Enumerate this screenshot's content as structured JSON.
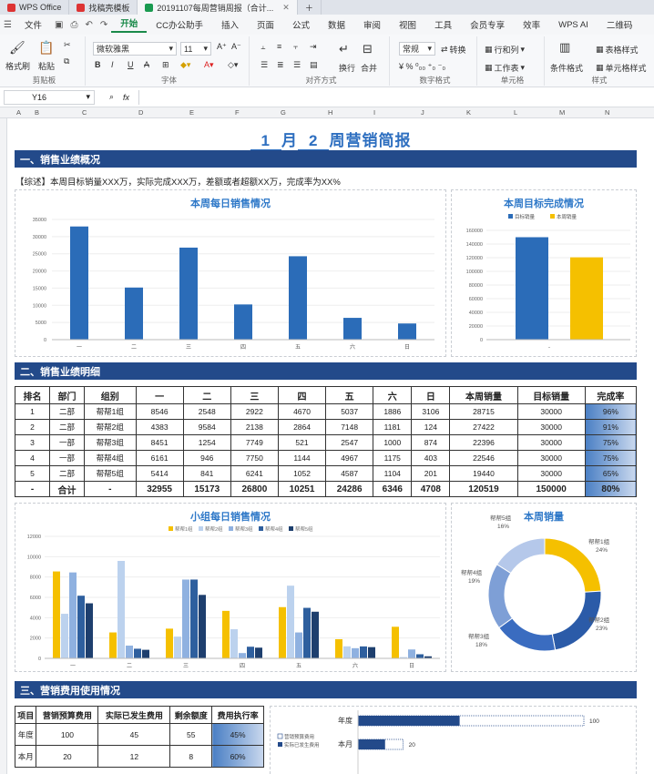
{
  "tabs": [
    {
      "label": "WPS Office",
      "color": "#d33"
    },
    {
      "label": "找稿壳模板",
      "color": "#d33"
    },
    {
      "label": "20191107每周营销周报（合计...",
      "color": "#1a9a50",
      "active": true
    }
  ],
  "menu": {
    "items": [
      "文件",
      "开始",
      "CC办公助手",
      "插入",
      "页面",
      "公式",
      "数据",
      "审阅",
      "视图",
      "工具",
      "会员专享",
      "效率",
      "WPS AI",
      "二维码"
    ],
    "active": "开始"
  },
  "ribbon": {
    "format_painter": "格式刷",
    "paste": "粘贴",
    "clipboard": "剪贴板",
    "font_name": "微软雅黑",
    "font_size": "11",
    "font": "字体",
    "wrap": "换行",
    "merge": "合并",
    "align": "对齐方式",
    "num_format": "常规",
    "convert": "转换",
    "numfmt": "数字格式",
    "rows_cols": "行和列",
    "worksheet": "工作表",
    "cells": "单元格",
    "cond_format": "条件格式",
    "table_style": "表格样式",
    "cell_style": "单元格样式",
    "styles": "样式"
  },
  "formula": {
    "cell": "Y16",
    "fx": "fx"
  },
  "columns": [
    "A",
    "B",
    "C",
    "D",
    "E",
    "F",
    "G",
    "H",
    "I",
    "J",
    "K",
    "L",
    "M",
    "N"
  ],
  "sheet": {
    "title_month": "1",
    "title_mid": "月",
    "title_week": "2",
    "title_tail": "周营销简报",
    "sec1": "一、销售业绩概况",
    "sec2": "二、销售业绩明细",
    "sec3": "三、营销费用使用情况",
    "summary": "【综述】本周目标销量XXX万，实际完成XXX万，差额或者超额XX万，完成率为XX%"
  },
  "chart_daily": {
    "title": "本周每日销售情况"
  },
  "chart_target": {
    "title": "本周目标完成情况",
    "legend": [
      "目标销量",
      "本周销量"
    ]
  },
  "chart_group": {
    "title": "小组每日销售情况",
    "legend": [
      "帮帮1组",
      "帮帮2组",
      "帮帮3组",
      "帮帮4组",
      "帮帮5组"
    ]
  },
  "chart_pie": {
    "title": "本周销量"
  },
  "detail": {
    "headers": [
      "排名",
      "部门",
      "组别",
      "一",
      "二",
      "三",
      "四",
      "五",
      "六",
      "日",
      "本周销量",
      "目标销量",
      "完成率"
    ],
    "rows": [
      [
        "1",
        "二部",
        "帮帮1组",
        "8546",
        "2548",
        "2922",
        "4670",
        "5037",
        "1886",
        "3106",
        "28715",
        "30000",
        "96%"
      ],
      [
        "2",
        "二部",
        "帮帮2组",
        "4383",
        "9584",
        "2138",
        "2864",
        "7148",
        "1181",
        "124",
        "27422",
        "30000",
        "91%"
      ],
      [
        "3",
        "一部",
        "帮帮3组",
        "8451",
        "1254",
        "7749",
        "521",
        "2547",
        "1000",
        "874",
        "22396",
        "30000",
        "75%"
      ],
      [
        "4",
        "一部",
        "帮帮4组",
        "6161",
        "946",
        "7750",
        "1144",
        "4967",
        "1175",
        "403",
        "22546",
        "30000",
        "75%"
      ],
      [
        "5",
        "二部",
        "帮帮5组",
        "5414",
        "841",
        "6241",
        "1052",
        "4587",
        "1104",
        "201",
        "19440",
        "30000",
        "65%"
      ]
    ],
    "total": [
      "-",
      "合计",
      "-",
      "32955",
      "15173",
      "26800",
      "10251",
      "24286",
      "6346",
      "4708",
      "120519",
      "150000",
      "80%"
    ]
  },
  "cost": {
    "headers": [
      "项目",
      "营销预算费用",
      "实际已发生费用",
      "剩余额度",
      "费用执行率"
    ],
    "rows": [
      [
        "年度",
        "100",
        "45",
        "55",
        "45%"
      ],
      [
        "本月",
        "20",
        "12",
        "8",
        "60%"
      ]
    ],
    "bar_legend": [
      "营销预算费用",
      "实际已发生费用"
    ]
  },
  "chart_data": [
    {
      "type": "bar",
      "title": "本周每日销售情况",
      "categories": [
        "一",
        "二",
        "三",
        "四",
        "五",
        "六",
        "日"
      ],
      "values": [
        32955,
        15173,
        26800,
        10251,
        24286,
        6346,
        4708
      ],
      "ylim": [
        0,
        35000
      ],
      "yticks": [
        0,
        5000,
        10000,
        15000,
        20000,
        25000,
        30000,
        35000
      ],
      "color": "#2b6cb8"
    },
    {
      "type": "bar",
      "title": "本周目标完成情况",
      "categories": [
        "-"
      ],
      "series": [
        {
          "name": "目标销量",
          "values": [
            150000
          ],
          "color": "#2b6cb8"
        },
        {
          "name": "本周销量",
          "values": [
            120519
          ],
          "color": "#f5c000"
        }
      ],
      "ylim": [
        0,
        160000
      ],
      "yticks": [
        0,
        20000,
        40000,
        60000,
        80000,
        100000,
        120000,
        140000,
        160000
      ]
    },
    {
      "type": "bar",
      "title": "小组每日销售情况",
      "categories": [
        "一",
        "二",
        "三",
        "四",
        "五",
        "六",
        "日"
      ],
      "ylim": [
        0,
        12000
      ],
      "yticks": [
        0,
        2000,
        4000,
        6000,
        8000,
        10000,
        12000
      ],
      "series": [
        {
          "name": "帮帮1组",
          "values": [
            8546,
            2548,
            2922,
            4670,
            5037,
            1886,
            3106
          ],
          "color": "#f5c000"
        },
        {
          "name": "帮帮2组",
          "values": [
            4383,
            9584,
            2138,
            2864,
            7148,
            1181,
            124
          ],
          "color": "#bcd2ee"
        },
        {
          "name": "帮帮3组",
          "values": [
            8451,
            1254,
            7749,
            521,
            2547,
            1000,
            874
          ],
          "color": "#8fb1e0"
        },
        {
          "name": "帮帮4组",
          "values": [
            6161,
            946,
            7750,
            1144,
            4967,
            1175,
            403
          ],
          "color": "#2e5f9e"
        },
        {
          "name": "帮帮5组",
          "values": [
            5414,
            841,
            6241,
            1052,
            4587,
            1104,
            201
          ],
          "color": "#1e3f6e"
        }
      ]
    },
    {
      "type": "pie",
      "title": "本周销量",
      "slices": [
        {
          "name": "帮帮1组",
          "value": 24,
          "color": "#f5c000"
        },
        {
          "name": "帮帮2组",
          "value": 23,
          "color": "#2b5ba8"
        },
        {
          "name": "帮帮3组",
          "value": 18,
          "color": "#3a6cc0"
        },
        {
          "name": "帮帮4组",
          "value": 19,
          "color": "#7e9fd6"
        },
        {
          "name": "帮帮5组",
          "value": 16,
          "color": "#b5c8ea"
        }
      ]
    },
    {
      "type": "bar",
      "title": "",
      "categories": [
        "年度",
        "本月"
      ],
      "series": [
        {
          "name": "营销预算费用",
          "values": [
            100,
            20
          ]
        },
        {
          "name": "实际已发生费用",
          "values": [
            45,
            12
          ]
        }
      ],
      "xlim": [
        0,
        100
      ]
    }
  ]
}
